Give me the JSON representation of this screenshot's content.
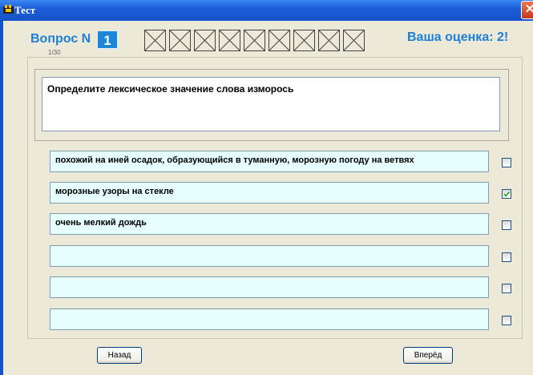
{
  "window": {
    "title": "Тест",
    "close_glyph": "✕"
  },
  "header": {
    "question_label": "Вопрос N",
    "question_number": "1",
    "sub_caption": "1/30",
    "grade": "Ваша оценка: 2!",
    "progress_boxes": 9
  },
  "question": {
    "text": "Определите лексическое значение слова изморось"
  },
  "answers": [
    {
      "text": "похожий на иней осадок, образующийся в туманную, морозную погоду на ветвях",
      "checked": false
    },
    {
      "text": "морозные узоры на стекле",
      "checked": true
    },
    {
      "text": "очень мелкий дождь",
      "checked": false
    },
    {
      "text": "",
      "checked": false
    },
    {
      "text": "",
      "checked": false
    },
    {
      "text": "",
      "checked": false
    }
  ],
  "buttons": {
    "back": "Назад",
    "forward": "Вперёд"
  },
  "colors": {
    "accent": "#1e7fd6",
    "answer_bg": "#e6fefe",
    "window_bg": "#ece9d8",
    "titlebar": "#1553c8"
  }
}
